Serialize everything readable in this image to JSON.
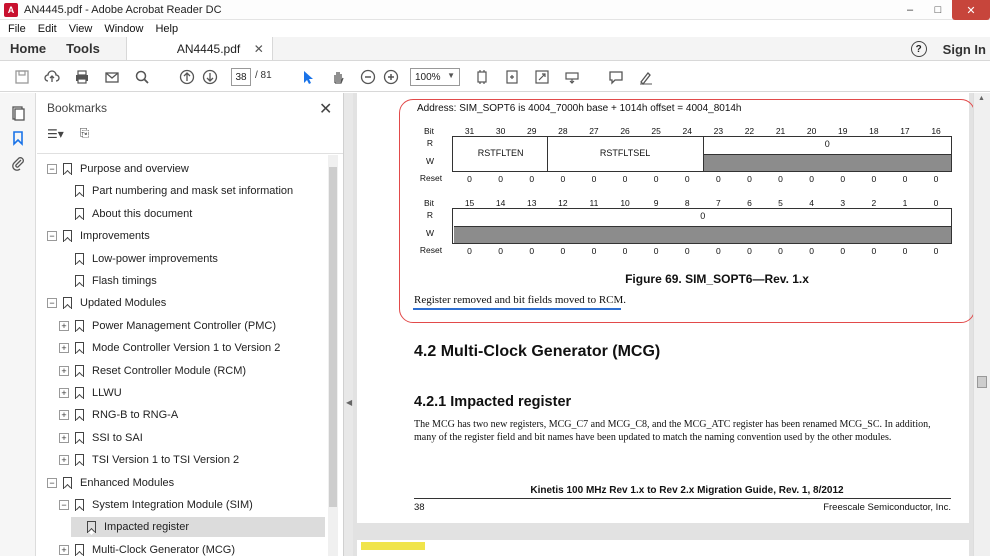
{
  "window": {
    "title": "AN4445.pdf - Adobe Acrobat Reader DC",
    "minimize": "–",
    "maximize": "□",
    "close": "✕"
  },
  "menu": [
    "File",
    "Edit",
    "View",
    "Window",
    "Help"
  ],
  "nav": {
    "home": "Home",
    "tools": "Tools",
    "doc_tab": "AN4445.pdf",
    "doc_tab_close": "✕",
    "help": "?",
    "sign_in": "Sign In"
  },
  "toolbar": {
    "page_current": "38",
    "page_total": "/ 81",
    "zoom": "100%"
  },
  "bookmarks": {
    "header": "Bookmarks",
    "close": "✕",
    "items": [
      {
        "label": "Purpose and overview",
        "level": 0,
        "expander": "−"
      },
      {
        "label": "Part numbering and mask set information",
        "level": 1,
        "expander": ""
      },
      {
        "label": "About this document",
        "level": 1,
        "expander": ""
      },
      {
        "label": "Improvements",
        "level": 0,
        "expander": "−"
      },
      {
        "label": "Low-power improvements",
        "level": 1,
        "expander": ""
      },
      {
        "label": "Flash timings",
        "level": 1,
        "expander": ""
      },
      {
        "label": "Updated Modules",
        "level": 0,
        "expander": "−"
      },
      {
        "label": "Power Management Controller (PMC)",
        "level": 1,
        "expander": "+"
      },
      {
        "label": "Mode Controller Version 1 to Version 2",
        "level": 1,
        "expander": "+"
      },
      {
        "label": "Reset Controller Module (RCM)",
        "level": 1,
        "expander": "+"
      },
      {
        "label": "LLWU",
        "level": 1,
        "expander": "+"
      },
      {
        "label": "RNG-B to RNG-A",
        "level": 1,
        "expander": "+"
      },
      {
        "label": "SSI to SAI",
        "level": 1,
        "expander": "+"
      },
      {
        "label": "TSI Version 1 to TSI Version 2",
        "level": 1,
        "expander": "+"
      },
      {
        "label": "Enhanced Modules",
        "level": 0,
        "expander": "−"
      },
      {
        "label": "System Integration Module (SIM)",
        "level": 1,
        "expander": "−"
      },
      {
        "label": "Impacted register",
        "level": 2,
        "expander": "",
        "selected": true
      },
      {
        "label": "Multi-Clock Generator (MCG)",
        "level": 1,
        "expander": "+"
      }
    ]
  },
  "document": {
    "address": "Address: SIM_SOPT6 is 4004_7000h base + 1014h offset = 4004_8014h",
    "bit_label": "Bit",
    "r_label": "R",
    "w_label": "W",
    "reset_label": "Reset",
    "upper_bits": [
      "31",
      "30",
      "29",
      "28",
      "27",
      "26",
      "25",
      "24",
      "23",
      "22",
      "21",
      "20",
      "19",
      "18",
      "17",
      "16"
    ],
    "lower_bits": [
      "15",
      "14",
      "13",
      "12",
      "11",
      "10",
      "9",
      "8",
      "7",
      "6",
      "5",
      "4",
      "3",
      "2",
      "1",
      "0"
    ],
    "field_rstflten": "RSTFLTEN",
    "field_rstfltsel": "RSTFLTSEL",
    "upper_zero_field": "0",
    "lower_zero_field": "0",
    "reset_values": [
      "0",
      "0",
      "0",
      "0",
      "0",
      "0",
      "0",
      "0",
      "0",
      "0",
      "0",
      "0",
      "0",
      "0",
      "0",
      "0"
    ],
    "figure_caption": "Figure 69. SIM_SOPT6—Rev. 1.x",
    "note": "Register removed and bit fields moved to RCM.",
    "h42": "4.2   Multi-Clock Generator (MCG)",
    "h421": "4.2.1   Impacted register",
    "paragraph": "The MCG has two new registers, MCG_C7 and MCG_C8, and the MCG_ATC register has been renamed MCG_SC. In addition, many of the register field and bit names have been updated to match the naming convention used by the other modules.",
    "footer_title": "Kinetis 100 MHz Rev 1.x to Rev 2.x Migration Guide, Rev. 1, 8/2012",
    "page_number": "38",
    "footer_company": "Freescale Semiconductor, Inc."
  },
  "colors": {
    "callout_border": "#e24a4a",
    "note_underline": "#2e6fd1",
    "field_grey": "#8c8c8c",
    "close_button": "#c7453b"
  }
}
